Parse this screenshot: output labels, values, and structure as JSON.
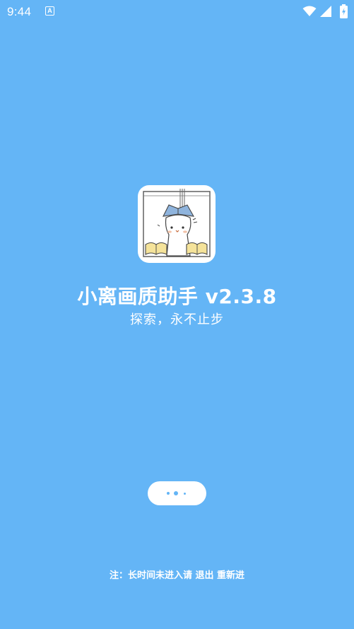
{
  "status_bar": {
    "time": "9:44",
    "notification_icon": "a-notification-icon",
    "wifi_icon": "wifi-icon",
    "signal_icon": "cell-signal-icon",
    "battery_icon": "battery-charging-icon"
  },
  "splash": {
    "app_icon": "cat-reading-book-illustration",
    "title": "小离画质助手 v2.3.8",
    "subtitle": "探索，永不止步",
    "loading_indicator": "three-dots-loading",
    "footer_note": "注：长时间未进入请 退出 重新进"
  },
  "colors": {
    "background": "#64b5f6",
    "text": "#ffffff",
    "pill": "#ffffff"
  }
}
